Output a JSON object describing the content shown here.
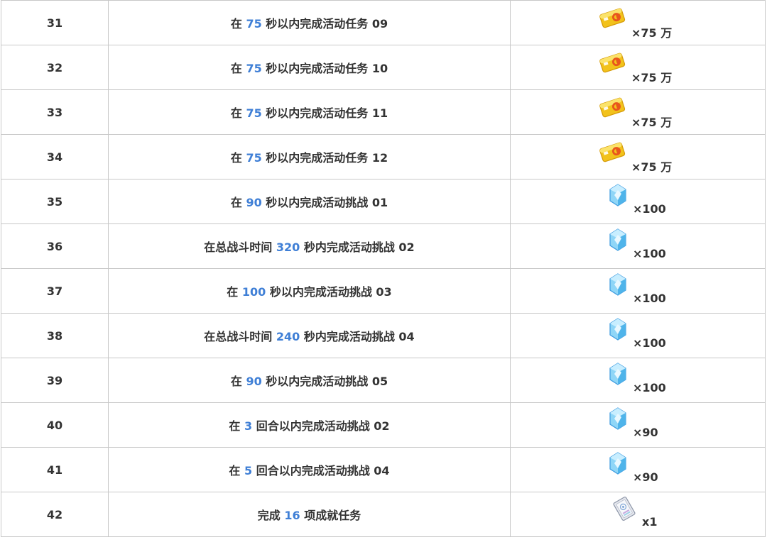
{
  "icons": {
    "money": "gold-card-icon",
    "crystal": "blue-crystal-icon",
    "ticket": "silver-ticket-icon"
  },
  "colors": {
    "highlight": "#3f7fd6",
    "text": "#333333",
    "border": "#c8c8c8"
  },
  "rows": [
    {
      "index": "31",
      "pre": "在 ",
      "num": "75",
      "post": " 秒以内完成活动任务 09",
      "reward": "money",
      "qty": "×75 万"
    },
    {
      "index": "32",
      "pre": "在 ",
      "num": "75",
      "post": " 秒以内完成活动任务 10",
      "reward": "money",
      "qty": "×75 万"
    },
    {
      "index": "33",
      "pre": "在 ",
      "num": "75",
      "post": " 秒以内完成活动任务 11",
      "reward": "money",
      "qty": "×75 万"
    },
    {
      "index": "34",
      "pre": "在 ",
      "num": "75",
      "post": " 秒以内完成活动任务 12",
      "reward": "money",
      "qty": "×75 万"
    },
    {
      "index": "35",
      "pre": "在 ",
      "num": "90",
      "post": " 秒以内完成活动挑战 01",
      "reward": "crystal",
      "qty": "×100"
    },
    {
      "index": "36",
      "pre": "在总战斗时间 ",
      "num": "320",
      "post": " 秒内完成活动挑战 02",
      "reward": "crystal",
      "qty": "×100"
    },
    {
      "index": "37",
      "pre": "在 ",
      "num": "100",
      "post": " 秒以内完成活动挑战 03",
      "reward": "crystal",
      "qty": "×100"
    },
    {
      "index": "38",
      "pre": "在总战斗时间 ",
      "num": "240",
      "post": " 秒内完成活动挑战 04",
      "reward": "crystal",
      "qty": "×100"
    },
    {
      "index": "39",
      "pre": "在 ",
      "num": "90",
      "post": " 秒以内完成活动挑战 05",
      "reward": "crystal",
      "qty": "×100"
    },
    {
      "index": "40",
      "pre": "在 ",
      "num": "3",
      "post": " 回合以内完成活动挑战 02",
      "reward": "crystal",
      "qty": "×90"
    },
    {
      "index": "41",
      "pre": "在 ",
      "num": "5",
      "post": " 回合以内完成活动挑战 04",
      "reward": "crystal",
      "qty": "×90"
    },
    {
      "index": "42",
      "pre": "完成 ",
      "num": "16",
      "post": " 项成就任务",
      "reward": "ticket",
      "qty": "x1"
    }
  ]
}
